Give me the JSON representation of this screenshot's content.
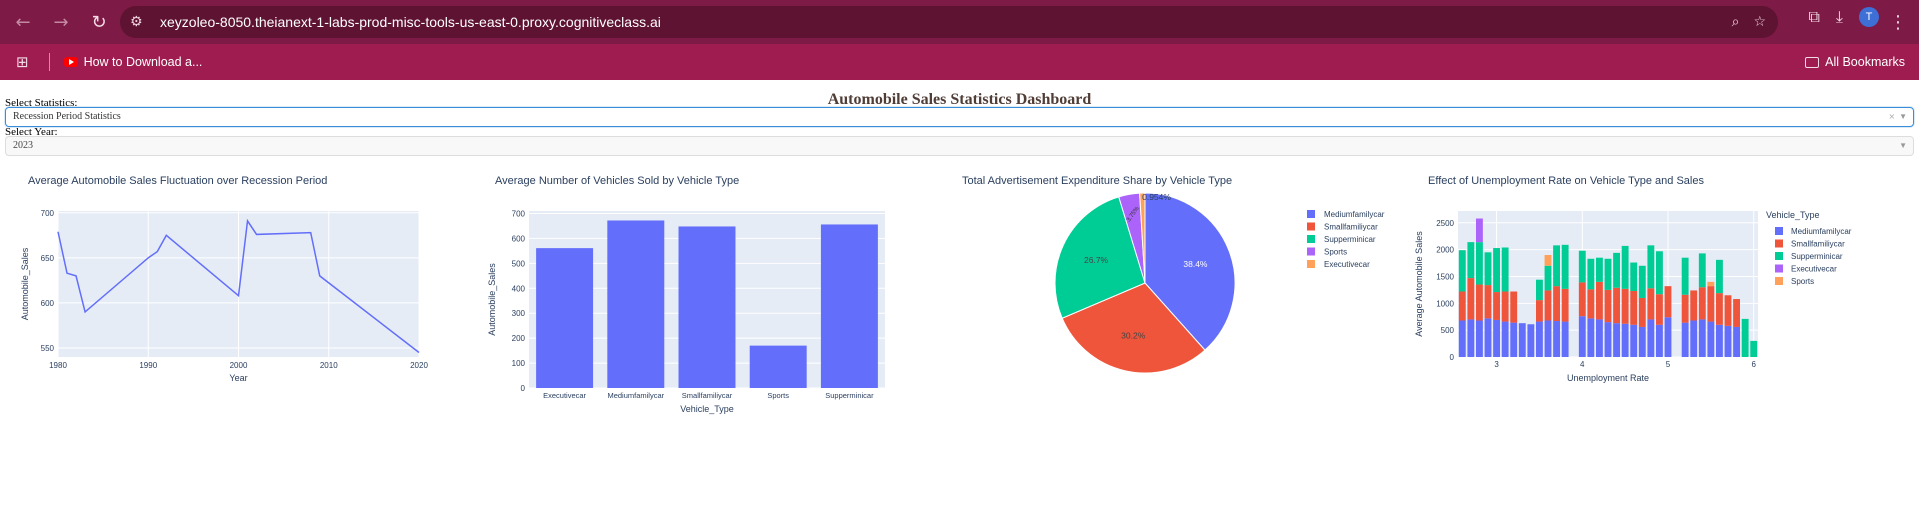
{
  "browser": {
    "url": "xeyzoleo-8050.theianext-1-labs-prod-misc-tools-us-east-0.proxy.cognitiveclass.ai",
    "avatar_letter": "T",
    "bookmark_item": "How to Download a...",
    "all_bookmarks": "All Bookmarks"
  },
  "dashboard": {
    "title": "Automobile Sales Statistics Dashboard",
    "stat_label": "Select Statistics:",
    "stat_value": "Recession Period Statistics",
    "year_label": "Select Year:",
    "year_value": "2023"
  },
  "colors": {
    "medium": "#636efa",
    "small": "#ef553b",
    "supermini": "#00cc96",
    "sports": "#ab63fa",
    "executive": "#ffa15a",
    "plot_bg": "#e5ecf6"
  },
  "chart_data": [
    {
      "type": "line",
      "title": "Average Automobile Sales Fluctuation over Recession Period",
      "xlabel": "Year",
      "ylabel": "Automobile_Sales",
      "x": [
        1980,
        1981,
        1982,
        1983,
        1990,
        1991,
        1992,
        2000,
        2001,
        2002,
        2008,
        2009,
        2020
      ],
      "y": [
        679,
        633,
        630,
        590,
        650,
        657,
        675,
        608,
        691,
        676,
        678,
        630,
        545
      ],
      "xlim": [
        1980,
        2020
      ],
      "ylim": [
        540,
        702
      ],
      "xticks": [
        1980,
        1990,
        2000,
        2010,
        2020
      ],
      "yticks": [
        550,
        600,
        650,
        700
      ]
    },
    {
      "type": "bar",
      "title": "Average Number of Vehicles Sold by Vehicle Type",
      "xlabel": "Vehicle_Type",
      "ylabel": "Automobile_Sales",
      "categories": [
        "Executivecar",
        "Mediumfamilycar",
        "Smallfamiliycar",
        "Sports",
        "Supperminicar"
      ],
      "values": [
        561,
        672,
        648,
        170,
        656
      ],
      "ylim": [
        0,
        710
      ],
      "yticks": [
        0,
        100,
        200,
        300,
        400,
        500,
        600,
        700
      ]
    },
    {
      "type": "pie",
      "title": "Total Advertisement Expenditure Share by Vehicle Type",
      "labels": [
        "Mediumfamilycar",
        "Smallfamiliycar",
        "Supperminicar",
        "Sports",
        "Executivecar"
      ],
      "values": [
        38.4,
        30.2,
        26.7,
        3.75,
        0.954
      ],
      "display_labels": [
        "38.4%",
        "30.2%",
        "26.7%",
        "3.75%",
        "0.954%"
      ],
      "legend": "right"
    },
    {
      "type": "bar",
      "title": "Effect of Unemployment Rate on Vehicle Type and Sales",
      "xlabel": "Unemployment Rate",
      "ylabel": "Average Automobile Sales",
      "legend_title": "Vehicle_Type",
      "legend_items": [
        "Mediumfamilycar",
        "Smallfamiliycar",
        "Supperminicar",
        "Executivecar",
        "Sports"
      ],
      "xlim": [
        2.55,
        6.05
      ],
      "ylim": [
        0,
        2720
      ],
      "xticks": [
        3,
        4,
        5,
        6
      ],
      "yticks": [
        0,
        500,
        1000,
        1500,
        2000,
        2500
      ],
      "x": [
        2.6,
        2.7,
        2.8,
        2.9,
        3.0,
        3.1,
        3.2,
        3.3,
        3.4,
        3.5,
        3.6,
        3.7,
        3.8,
        3.9,
        4.0,
        4.1,
        4.2,
        4.3,
        4.4,
        4.5,
        4.6,
        4.7,
        4.8,
        4.9,
        5.0,
        5.1,
        5.2,
        5.3,
        5.4,
        5.5,
        5.6,
        5.7,
        5.8,
        5.9,
        6.0
      ],
      "series": [
        {
          "name": "Mediumfamilycar",
          "values": [
            680,
            700,
            680,
            720,
            690,
            660,
            640,
            630,
            610,
            660,
            680,
            670,
            660,
            0,
            760,
            720,
            700,
            650,
            630,
            620,
            600,
            560,
            700,
            600,
            740,
            0,
            640,
            680,
            700,
            660,
            600,
            580,
            560,
            0,
            0
          ]
        },
        {
          "name": "Smallfamiliycar",
          "values": [
            540,
            770,
            670,
            620,
            520,
            560,
            580,
            0,
            0,
            400,
            560,
            650,
            610,
            0,
            630,
            540,
            700,
            600,
            660,
            650,
            630,
            540,
            580,
            570,
            580,
            0,
            520,
            560,
            600,
            660,
            590,
            570,
            520,
            0,
            0
          ]
        },
        {
          "name": "Supperminicar",
          "values": [
            770,
            670,
            790,
            610,
            820,
            820,
            0,
            0,
            0,
            380,
            460,
            760,
            820,
            0,
            590,
            570,
            450,
            580,
            650,
            800,
            530,
            600,
            800,
            800,
            0,
            0,
            690,
            0,
            630,
            0,
            620,
            0,
            0,
            710,
            300
          ]
        },
        {
          "name": "Executivecar",
          "values": [
            0,
            0,
            0,
            0,
            0,
            0,
            0,
            0,
            0,
            0,
            200,
            0,
            0,
            0,
            0,
            0,
            0,
            0,
            0,
            0,
            0,
            0,
            0,
            0,
            0,
            0,
            0,
            0,
            0,
            80,
            0,
            0,
            0,
            0,
            0
          ]
        },
        {
          "name": "Sports",
          "values": [
            0,
            0,
            440,
            0,
            0,
            0,
            0,
            0,
            0,
            0,
            0,
            0,
            0,
            0,
            0,
            0,
            0,
            0,
            0,
            0,
            0,
            0,
            0,
            0,
            0,
            0,
            0,
            0,
            0,
            0,
            0,
            0,
            0,
            0,
            0
          ]
        }
      ]
    }
  ]
}
